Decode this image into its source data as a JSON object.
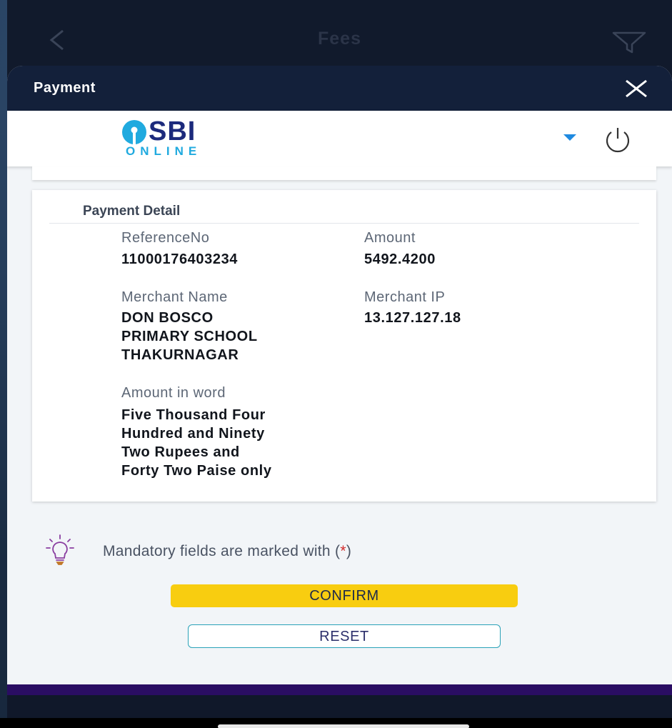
{
  "header": {
    "title": "Fees",
    "back_icon": "chevron-left-icon",
    "filter_icon": "filter-icon"
  },
  "sheet": {
    "title": "Payment",
    "close_icon": "close-icon"
  },
  "bank": {
    "logo_text": "SBI",
    "logo_subtext": "ONLINE",
    "dropdown_icon": "caret-down-icon",
    "power_icon": "power-icon"
  },
  "payment_detail": {
    "heading": "Payment Detail",
    "reference_no_label": "ReferenceNo",
    "reference_no_value": "11000176403234",
    "amount_label": "Amount",
    "amount_value": "5492.4200",
    "merchant_name_label": "Merchant Name",
    "merchant_name_lines": [
      "DON BOSCO",
      "PRIMARY SCHOOL",
      "THAKURNAGAR"
    ],
    "merchant_ip_label": "Merchant IP",
    "merchant_ip_value": "13.127.127.18",
    "amount_in_word_label": "Amount in word",
    "amount_in_word_lines": [
      "Five Thousand Four",
      "Hundred and Ninety",
      "Two Rupees and",
      "Forty Two Paise only"
    ]
  },
  "note": {
    "text": "Mandatory fields are marked with (",
    "star": "*",
    "close": ")",
    "icon": "lightbulb-icon"
  },
  "buttons": {
    "confirm": "CONFIRM",
    "reset": "RESET"
  },
  "colors": {
    "header_bg": "#13203a",
    "confirm_bg": "#f8cd10",
    "reset_border": "#2aa2b8",
    "accent_purple": "#2a0d63",
    "sbi_blue": "#1c2a7c",
    "sbi_cyan": "#20aadf"
  }
}
